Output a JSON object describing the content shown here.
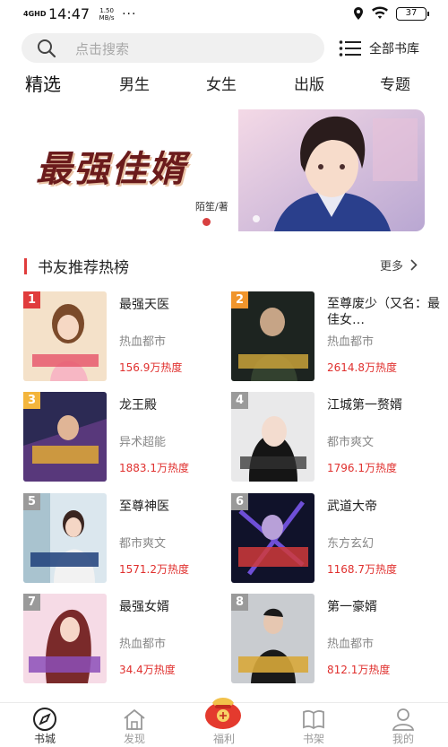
{
  "status": {
    "network": "4GHD",
    "time": "14:47",
    "speed": "1.50 MB/s",
    "dots": "···",
    "battery": "37"
  },
  "search": {
    "placeholder": "点击搜索",
    "all_books": "全部书库"
  },
  "tabs": [
    "精选",
    "男生",
    "女生",
    "出版",
    "专题"
  ],
  "banner": {
    "title": "最强佳婿",
    "author": "陌笙/著"
  },
  "section": {
    "title": "书友推荐热榜",
    "more": "更多"
  },
  "books": [
    {
      "rank": "1",
      "title": "最强天医",
      "category": "热血都市",
      "heat": "156.9万热度",
      "rank_color": "#e03c3c"
    },
    {
      "rank": "2",
      "title": "至尊废少（又名：最佳女…",
      "category": "热血都市",
      "heat": "2614.8万热度",
      "rank_color": "#f0952c"
    },
    {
      "rank": "3",
      "title": "龙王殿",
      "category": "异术超能",
      "heat": "1883.1万热度",
      "rank_color": "#f3b53c"
    },
    {
      "rank": "4",
      "title": "江城第一赘婿",
      "category": "都市爽文",
      "heat": "1796.1万热度",
      "rank_color": "#9a9a9a"
    },
    {
      "rank": "5",
      "title": "至尊神医",
      "category": "都市爽文",
      "heat": "1571.2万热度",
      "rank_color": "#9a9a9a"
    },
    {
      "rank": "6",
      "title": "武道大帝",
      "category": "东方玄幻",
      "heat": "1168.7万热度",
      "rank_color": "#9a9a9a"
    },
    {
      "rank": "7",
      "title": "最强女婿",
      "category": "热血都市",
      "heat": "34.4万热度",
      "rank_color": "#9a9a9a"
    },
    {
      "rank": "8",
      "title": "第一豪婿",
      "category": "热血都市",
      "heat": "812.1万热度",
      "rank_color": "#9a9a9a"
    }
  ],
  "nav": [
    {
      "label": "书城",
      "icon": "compass-icon"
    },
    {
      "label": "发现",
      "icon": "home-icon"
    },
    {
      "label": "福利",
      "icon": "lucky-bag-icon"
    },
    {
      "label": "书架",
      "icon": "book-icon"
    },
    {
      "label": "我的",
      "icon": "person-icon"
    }
  ],
  "colors": {
    "accent": "#e03c3c",
    "heat": "#e0302e"
  }
}
